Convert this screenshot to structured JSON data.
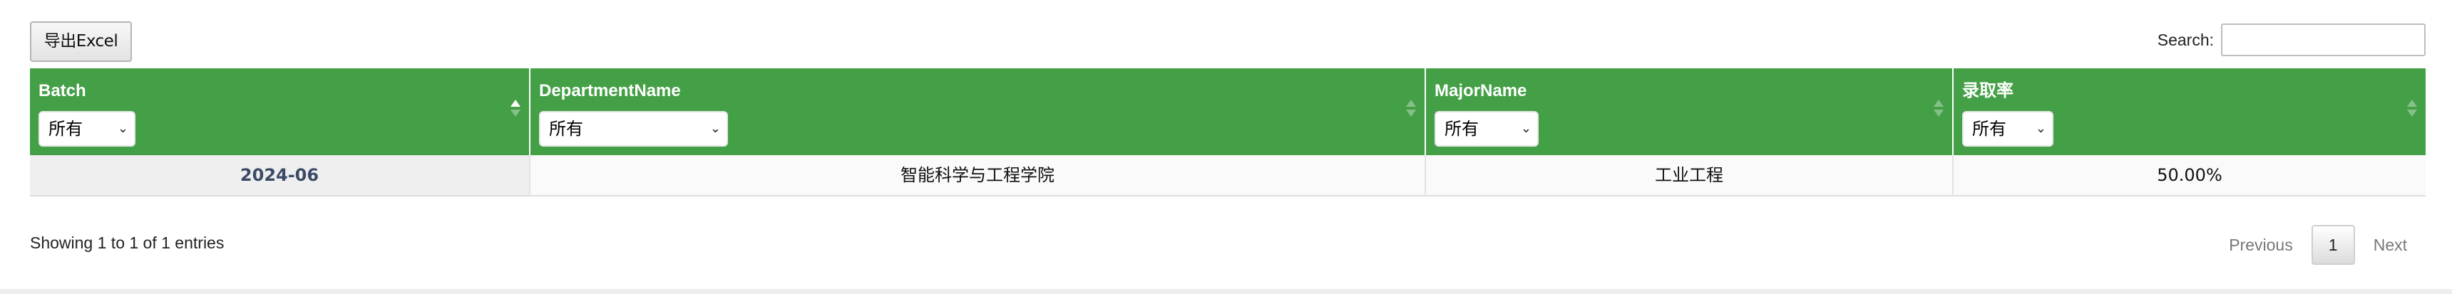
{
  "toolbar": {
    "export_label": "导出Excel",
    "search_label": "Search:",
    "search_value": ""
  },
  "table": {
    "columns": [
      {
        "label": "Batch",
        "filter": "所有"
      },
      {
        "label": "DepartmentName",
        "filter": "所有"
      },
      {
        "label": "MajorName",
        "filter": "所有"
      },
      {
        "label": "录取率",
        "filter": "所有"
      }
    ],
    "rows": [
      [
        "2024-06",
        "智能科学与工程学院",
        "工业工程",
        "50.00%"
      ]
    ]
  },
  "footer": {
    "info": "Showing 1 to 1 of 1 entries",
    "previous": "Previous",
    "page": "1",
    "next": "Next"
  },
  "colors": {
    "header_green": "#44a047"
  },
  "icons": {
    "sort": "sort-arrows-icon",
    "dropdown": "chevron-down-icon"
  }
}
